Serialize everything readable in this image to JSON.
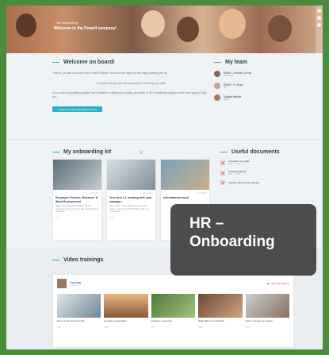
{
  "hero": {
    "breadcrumb": "My onboarding",
    "title": "Welcome to the Powell company!"
  },
  "welcome": {
    "title": "Welcome on board!",
    "intro": "That's it, you are now part of the Powell Software Team and we hope you will enjoy working with us.",
    "quote": "Our goal is to give you the opportunity to develop your skills.",
    "help": "If you have any questions please don't hesitate to contact your buddy, your team or HR: everybody would be more than happy to help you.",
    "cta": "ACCESS YOUR ONBOARDING PLAN"
  },
  "team": {
    "title": "My team",
    "members": [
      {
        "name": "DEMO - Frederic Le Roy",
        "role": "Team lead"
      },
      {
        "name": "DEMO - Hr Team",
        "role": "HR"
      },
      {
        "name": "Sabrina Mercier",
        "role": "Buddy"
      }
    ]
  },
  "kit": {
    "title": "My onboarding kit",
    "count": "4",
    "cards": [
      {
        "date": "12/01/2021",
        "title": "Employee Policies, Behavior, & Work Environment",
        "desc": "Welcome to Powell Software. As an employee here, you have the opportunity to follow the...",
        "meta": "2 min"
      },
      {
        "date": "12/01/2021",
        "title": "Your first 1-1 meeting with your manager",
        "desc": "Meet is the most valuable asset to your career; why do you think? More than you ever have?",
        "meta": "2 min"
      },
      {
        "date": "12/01/2021",
        "title": "International travel",
        "desc": "",
        "meta": ""
      }
    ]
  },
  "documents": {
    "title": "Useful documents",
    "items": [
      {
        "name": "Travelled tour guide",
        "size": "PDF - 1.2 MB"
      },
      {
        "name": "Powell handbook",
        "size": "PDF - 2.4 MB"
      },
      {
        "name": "Internal rules and procedures",
        "size": ""
      }
    ]
  },
  "badge": {
    "line1": "HR –",
    "line2": "Onboarding"
  },
  "videos": {
    "title": "Video trainings",
    "channel": "Trainings",
    "channel_sub": "5 videos",
    "link": "Visit web channel",
    "items": [
      {
        "title": "How to book your desk with...",
        "meta": "2:45"
      },
      {
        "title": "Company presentation",
        "meta": "3:12"
      },
      {
        "title": "Integrate a new team",
        "meta": "4:05"
      },
      {
        "title": "What office do we forward",
        "meta": "1:58"
      },
      {
        "title": "Tips to manage your career",
        "meta": "2:30"
      }
    ]
  }
}
